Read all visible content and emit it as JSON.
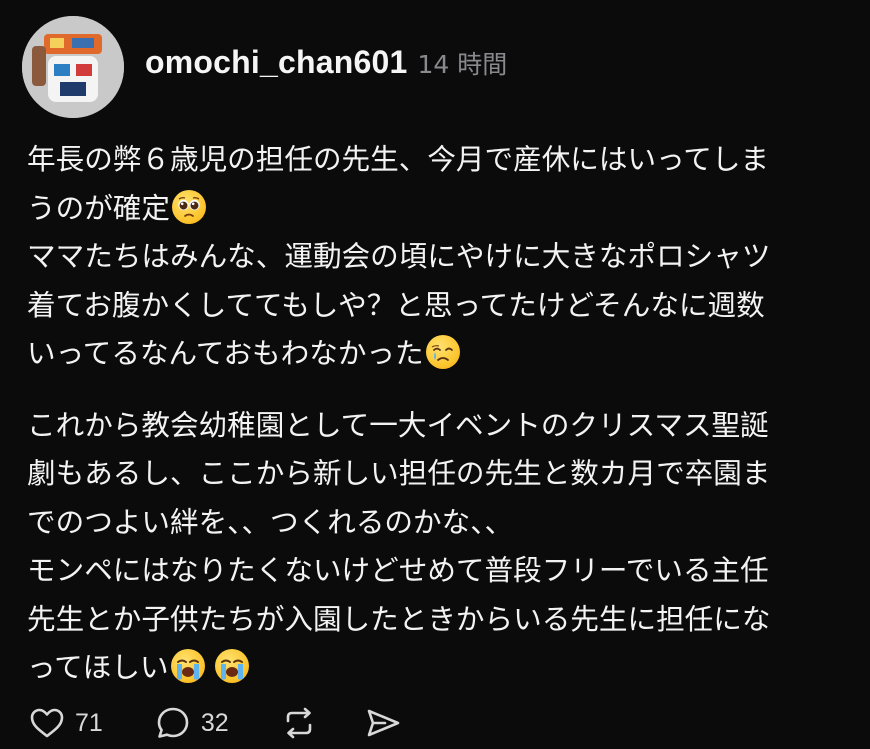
{
  "post": {
    "author": "omochi_chan601",
    "time": "14 時間",
    "lines": [
      "年長の弊６歳児の担任の先生、今月で産休にはいってしま",
      "うのが確定",
      "ママたちはみんな、運動会の頃にやけに大きなポロシャツ",
      "着てお腹かくしててもしや？と思ってたけどそんなに週数",
      "いってるなんておもわなかった",
      "これから教会幼稚園として一大イベントのクリスマス聖誕",
      "劇もあるし、ここから新しい担任の先生と数カ月で卒園ま",
      "でのつよい絆を、、つくれるのかな、、",
      "モンペにはなりたくないけどせめて普段フリーでいる主任",
      "先生とか子供たちが入園したときからいる先生に担任にな",
      "ってほしい"
    ],
    "emojis": {
      "line2": "pleading-face-icon",
      "line5": "face-holding-back-tears-icon",
      "line11": [
        "loudly-crying-face-icon",
        "loudly-crying-face-icon"
      ]
    }
  },
  "actions": {
    "like_count": "71",
    "reply_count": "32",
    "repost_icon": "repost-icon",
    "share_icon": "send-icon"
  },
  "colors": {
    "background": "#0b0b0c",
    "text": "#f3f3f3",
    "muted": "#8a8a8e",
    "emoji": "#fcc42c"
  }
}
